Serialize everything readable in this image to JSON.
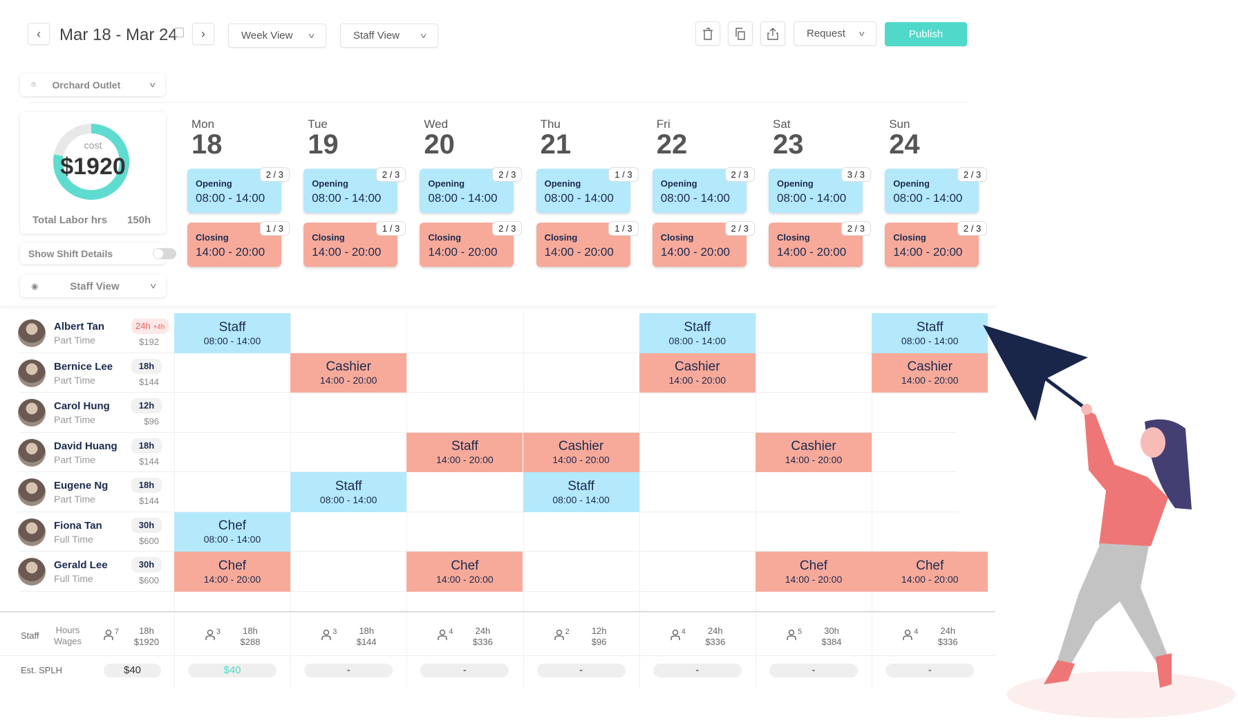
{
  "toolbar": {
    "date_range": "Mar 18 - Mar 24",
    "week_view": "Week View",
    "staff_view": "Staff View",
    "request": "Request",
    "publish": "Publish"
  },
  "sidebar": {
    "location": "Orchard Outlet",
    "cost_label": "cost",
    "cost_value": "$1920",
    "cost_fill": 0.78,
    "total_labor_label": "Total Labor hrs",
    "total_labor_value": "150h",
    "show_shift_details": "Show Shift Details",
    "show_shift_details_on": false,
    "view_filter": "Staff View"
  },
  "colors": {
    "opening": "#b4e9fc",
    "closing": "#f8aa9a",
    "accent": "#50d9ca",
    "text": "#1b2a4e"
  },
  "days": [
    {
      "name": "Mon",
      "num": "18",
      "opening": {
        "label": "Opening",
        "time": "08:00 - 14:00",
        "filled": "2 / 3"
      },
      "closing": {
        "label": "Closing",
        "time": "14:00 - 20:00",
        "filled": "1 / 3"
      }
    },
    {
      "name": "Tue",
      "num": "19",
      "opening": {
        "label": "Opening",
        "time": "08:00 - 14:00",
        "filled": "2 / 3"
      },
      "closing": {
        "label": "Closing",
        "time": "14:00 - 20:00",
        "filled": "1 / 3"
      }
    },
    {
      "name": "Wed",
      "num": "20",
      "opening": {
        "label": "Opening",
        "time": "08:00 - 14:00",
        "filled": "2 / 3"
      },
      "closing": {
        "label": "Closing",
        "time": "14:00 - 20:00",
        "filled": "2 / 3"
      }
    },
    {
      "name": "Thu",
      "num": "21",
      "opening": {
        "label": "Opening",
        "time": "08:00 - 14:00",
        "filled": "1 / 3"
      },
      "closing": {
        "label": "Closing",
        "time": "14:00 - 20:00",
        "filled": "1 / 3"
      }
    },
    {
      "name": "Fri",
      "num": "22",
      "opening": {
        "label": "Opening",
        "time": "08:00 - 14:00",
        "filled": "2 / 3"
      },
      "closing": {
        "label": "Closing",
        "time": "14:00 - 20:00",
        "filled": "2 / 3"
      }
    },
    {
      "name": "Sat",
      "num": "23",
      "opening": {
        "label": "Opening",
        "time": "08:00 - 14:00",
        "filled": "3 / 3"
      },
      "closing": {
        "label": "Closing",
        "time": "14:00 - 20:00",
        "filled": "2 / 3"
      }
    },
    {
      "name": "Sun",
      "num": "24",
      "opening": {
        "label": "Opening",
        "time": "08:00 - 14:00",
        "filled": "2 / 3"
      },
      "closing": {
        "label": "Closing",
        "time": "14:00 - 20:00",
        "filled": "2 / 3"
      }
    }
  ],
  "staff": [
    {
      "name": "Albert Tan",
      "type": "Part Time",
      "hours": "24h",
      "overtime": "+4h",
      "wage": "$192",
      "shifts": [
        {
          "day": 0,
          "role": "Staff",
          "time": "08:00 - 14:00",
          "kind": "opening"
        },
        {
          "day": 4,
          "role": "Staff",
          "time": "08:00 - 14:00",
          "kind": "opening"
        },
        {
          "day": 6,
          "role": "Staff",
          "time": "08:00 - 14:00",
          "kind": "opening"
        }
      ]
    },
    {
      "name": "Bernice Lee",
      "type": "Part Time",
      "hours": "18h",
      "wage": "$144",
      "shifts": [
        {
          "day": 1,
          "role": "Cashier",
          "time": "14:00 - 20:00",
          "kind": "closing"
        },
        {
          "day": 4,
          "role": "Cashier",
          "time": "14:00 - 20:00",
          "kind": "closing"
        },
        {
          "day": 6,
          "role": "Cashier",
          "time": "14:00 - 20:00",
          "kind": "closing"
        }
      ]
    },
    {
      "name": "Carol Hung",
      "type": "Part Time",
      "hours": "12h",
      "wage": "$96",
      "shifts": []
    },
    {
      "name": "David Huang",
      "type": "Part Time",
      "hours": "18h",
      "wage": "$144",
      "shifts": [
        {
          "day": 2,
          "role": "Staff",
          "time": "14:00 - 20:00",
          "kind": "closing"
        },
        {
          "day": 3,
          "role": "Cashier",
          "time": "14:00 - 20:00",
          "kind": "closing"
        },
        {
          "day": 5,
          "role": "Cashier",
          "time": "14:00 - 20:00",
          "kind": "closing"
        }
      ]
    },
    {
      "name": "Eugene Ng",
      "type": "Part Time",
      "hours": "18h",
      "wage": "$144",
      "shifts": [
        {
          "day": 1,
          "role": "Staff",
          "time": "08:00 - 14:00",
          "kind": "opening"
        },
        {
          "day": 3,
          "role": "Staff",
          "time": "08:00 - 14:00",
          "kind": "opening"
        }
      ]
    },
    {
      "name": "Fiona Tan",
      "type": "Full Time",
      "hours": "30h",
      "wage": "$600",
      "shifts": [
        {
          "day": 0,
          "role": "Chef",
          "time": "08:00 - 14:00",
          "kind": "opening"
        }
      ]
    },
    {
      "name": "Gerald Lee",
      "type": "Full Time",
      "hours": "30h",
      "wage": "$600",
      "shifts": [
        {
          "day": 0,
          "role": "Chef",
          "time": "14:00 - 20:00",
          "kind": "closing"
        },
        {
          "day": 2,
          "role": "Chef",
          "time": "14:00 - 20:00",
          "kind": "closing"
        },
        {
          "day": 5,
          "role": "Chef",
          "time": "14:00 - 20:00",
          "kind": "closing"
        },
        {
          "day": 6,
          "role": "Chef",
          "time": "14:00 - 20:00",
          "kind": "closing"
        }
      ]
    }
  ],
  "footer": {
    "staff_label": "Staff",
    "hours_label": "Hours",
    "wages_label": "Wages",
    "splh_label": "Est. SPLH",
    "total": {
      "count": "7",
      "hours": "18h",
      "wages": "$1920",
      "splh": "$40"
    },
    "days": [
      {
        "count": "3",
        "hours": "18h",
        "wages": "$288",
        "splh": "$40"
      },
      {
        "count": "3",
        "hours": "18h",
        "wages": "$144",
        "splh": "-"
      },
      {
        "count": "4",
        "hours": "24h",
        "wages": "$336",
        "splh": "-"
      },
      {
        "count": "2",
        "hours": "12h",
        "wages": "$96",
        "splh": "-"
      },
      {
        "count": "4",
        "hours": "24h",
        "wages": "$336",
        "splh": "-"
      },
      {
        "count": "5",
        "hours": "30h",
        "wages": "$384",
        "splh": "-"
      },
      {
        "count": "4",
        "hours": "24h",
        "wages": "$336",
        "splh": "-"
      }
    ]
  }
}
